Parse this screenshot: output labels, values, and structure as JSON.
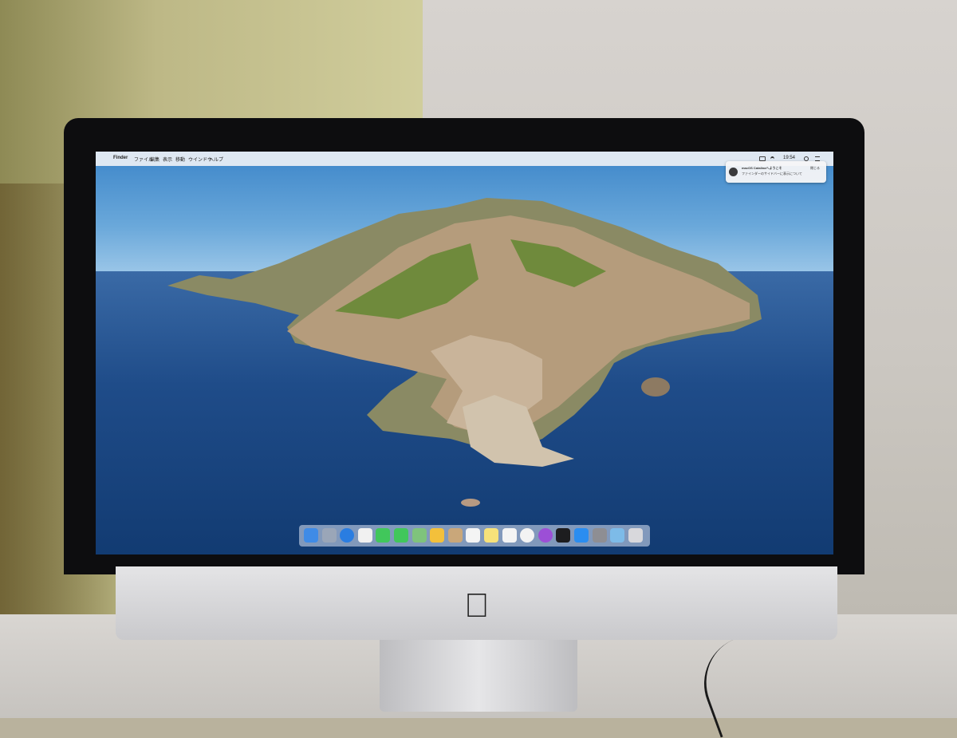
{
  "menubar": {
    "apple": "",
    "app": "Finder",
    "items": [
      "ファイル",
      "編集",
      "表示",
      "移動",
      "ウインドウ",
      "ヘルプ"
    ],
    "time": "19:54"
  },
  "notification": {
    "title": "macOS Catalinaへようこそ",
    "body": "ファインダーのサイドバーに表示について",
    "action": "閉じる"
  },
  "dock": {
    "icons": [
      "finder-icon",
      "launchpad-icon",
      "safari-icon",
      "photos-icon",
      "messages-icon",
      "facetime-icon",
      "maps-icon",
      "photos-app-icon",
      "contacts-icon",
      "calendar-icon",
      "notes-icon",
      "reminders-icon",
      "music-icon",
      "podcasts-icon",
      "tv-icon",
      "app-store-icon",
      "system-preferences-icon",
      "downloads-folder-icon",
      "trash-icon"
    ],
    "colors": [
      "#3f8be6",
      "#9aa6b8",
      "#2a7de1",
      "#f1f1f1",
      "#41c75b",
      "#41c75b",
      "#7fc37c",
      "#f3c03b",
      "#c9a77a",
      "#f4f4f4",
      "#f7e27a",
      "#f4f4f4",
      "#f3f3f3",
      "#9c4fd6",
      "#1d1d1f",
      "#2a8df0",
      "#8e8e93",
      "#7dbbe8",
      "#d8d8dc"
    ]
  },
  "colors": {
    "bezel": "#0d0d0f",
    "sky": "#6aa8da",
    "sea": "#1f4c89",
    "aluminum": "#d6d6d8"
  }
}
